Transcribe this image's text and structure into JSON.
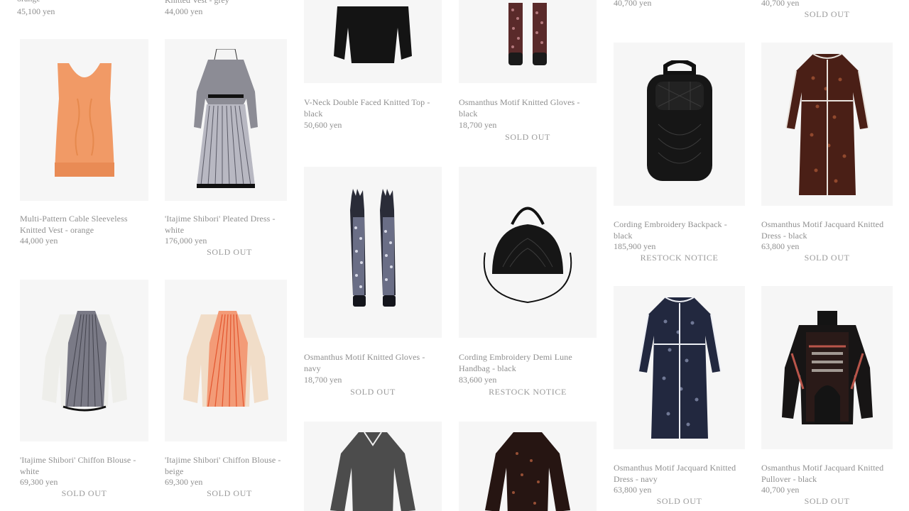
{
  "products": {
    "top_left_1": {
      "price": "45,100 yen",
      "name_tail": "orange"
    },
    "top_left_2": {
      "name_tail": "Knitted Vest - grey",
      "price": "44,000 yen"
    },
    "top_right_1": {
      "price": "40,700 yen"
    },
    "top_right_2": {
      "price": "40,700 yen",
      "status": "SOLD OUT"
    },
    "p1": {
      "name": "Multi-Pattern Cable Sleeveless Knitted Vest - orange",
      "price": "44,000 yen"
    },
    "p2": {
      "name": "'Itajime Shibori' Pleated Dress - white",
      "price": "176,000 yen",
      "status": "SOLD OUT"
    },
    "p3": {
      "name": "V-Neck Double Faced Knitted Top - black",
      "price": "50,600 yen"
    },
    "p4": {
      "name": "Osmanthus Motif Knitted Gloves - black",
      "price": "18,700 yen",
      "status": "SOLD OUT"
    },
    "p5": {
      "name": "Cording Embroidery Backpack - black",
      "price": "185,900 yen",
      "status": "RESTOCK NOTICE"
    },
    "p6": {
      "name": "Osmanthus Motif Jacquard Knitted Dress - black",
      "price": "63,800 yen",
      "status": "SOLD OUT"
    },
    "p7": {
      "name": "'Itajime Shibori' Chiffon Blouse - white",
      "price": "69,300 yen",
      "status": "SOLD OUT"
    },
    "p8": {
      "name": "'Itajime Shibori' Chiffon Blouse - beige",
      "price": "69,300 yen",
      "status": "SOLD OUT"
    },
    "p9": {
      "name": "Osmanthus Motif Knitted Gloves - navy",
      "price": "18,700 yen",
      "status": "SOLD OUT"
    },
    "p10": {
      "name": "Cording Embroidery Demi Lune Handbag - black",
      "price": "83,600 yen",
      "status": "RESTOCK NOTICE"
    },
    "p11": {
      "name": "Osmanthus Motif Jacquard Knitted Dress - navy",
      "price": "63,800 yen",
      "status": "SOLD OUT"
    },
    "p12": {
      "name": "Osmanthus Motif Jacquard Knitted Pullover - black",
      "price": "40,700 yen",
      "status": "SOLD OUT"
    }
  },
  "image_icons": {
    "p1": "orange-knit-vest-image",
    "p2": "pleated-dress-image",
    "p3": "black-knit-top-image",
    "p4": "black-gloves-image",
    "p5": "black-backpack-image",
    "p6": "black-jacquard-dress-image",
    "p7": "white-blouse-image",
    "p8": "beige-blouse-image",
    "p9": "navy-gloves-image",
    "p10": "black-handbag-image",
    "p11": "navy-jacquard-dress-image",
    "p12": "black-pullover-image",
    "p13": "grey-dress-image",
    "p14": "floral-dress-image"
  },
  "colors": {
    "thumb_bg": "#f6f6f6",
    "text": "#8f8f8f",
    "orange": "#f19a66",
    "black": "#151515"
  }
}
